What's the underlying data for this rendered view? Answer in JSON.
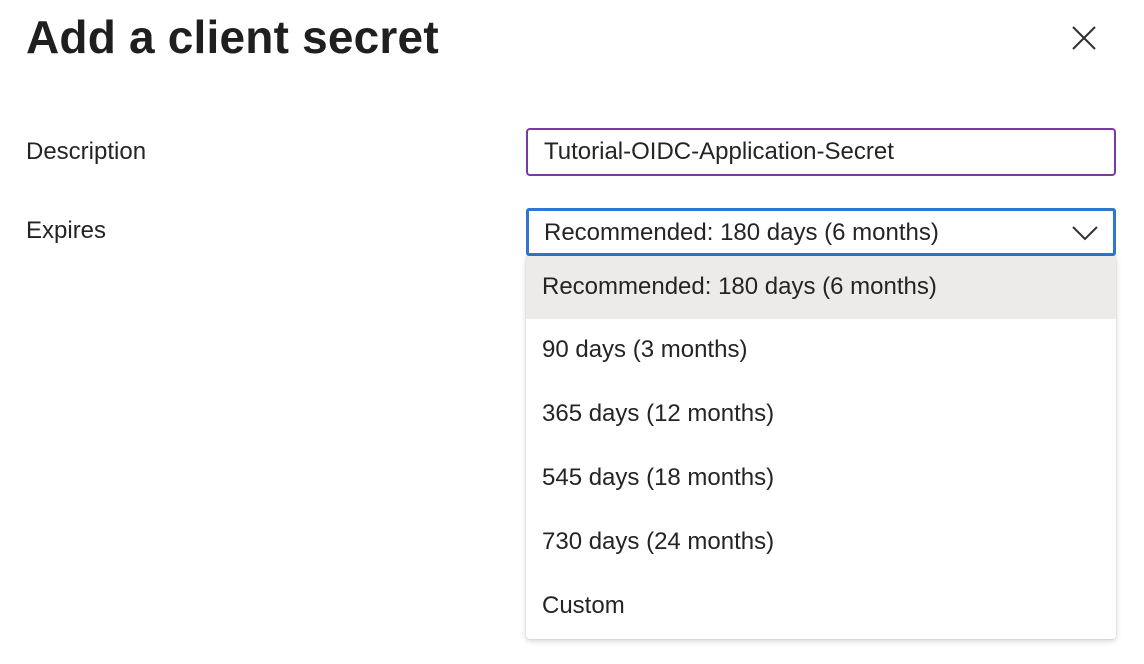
{
  "dialog": {
    "title": "Add a client secret",
    "close_icon": "close-icon"
  },
  "form": {
    "description": {
      "label": "Description",
      "value": "Tutorial-OIDC-Application-Secret"
    },
    "expires": {
      "label": "Expires",
      "selected": "Recommended: 180 days (6 months)",
      "chevron_icon": "chevron-down-icon",
      "options": [
        "Recommended: 180 days (6 months)",
        "90 days (3 months)",
        "365 days (12 months)",
        "545 days (18 months)",
        "730 days (24 months)",
        "Custom"
      ]
    }
  },
  "colors": {
    "input_border": "#7a3aa0",
    "select_border_focus": "#2f76cf",
    "selected_option_bg": "#edebe9"
  }
}
